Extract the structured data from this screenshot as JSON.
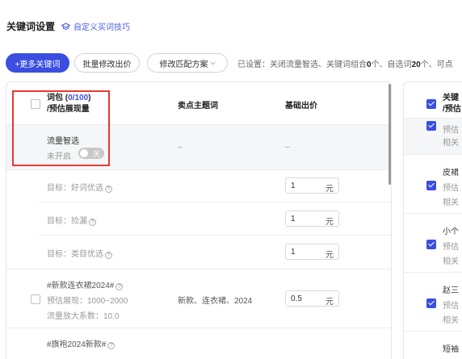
{
  "header": {
    "title": "关键词设置",
    "tip_label": "自定义买词技巧"
  },
  "toolbar": {
    "add_label": "+更多关键词",
    "bid_label": "批量修改出价",
    "match_label": "修改匹配方案",
    "status_prefix": "已设置：关闭流量智选、关键词组合",
    "combo_count": "0",
    "status_mid1": "个、自选词",
    "self_count": "20",
    "status_mid2": "个、可点"
  },
  "table": {
    "col_keyword_line1_pre": "词包 (",
    "col_keyword_count": "0/100",
    "col_keyword_line1_post": ")",
    "col_keyword_line2": "/预估展现量",
    "col_theme": "卖点主题词",
    "col_bid": "基础出价",
    "smart": {
      "name": "流量智选",
      "status": "未开启",
      "toggle": "关",
      "theme": "–",
      "bid": "–"
    },
    "targets": [
      {
        "label": "目标：好词优选",
        "bid": "1",
        "unit": "元"
      },
      {
        "label": "目标：捡漏",
        "bid": "1",
        "unit": "元"
      },
      {
        "label": "目标：类目优选",
        "bid": "1",
        "unit": "元"
      }
    ],
    "packages": [
      {
        "name": "#新款连衣裙2024#",
        "impression": "预估展现：1000~2000",
        "factor": "流量放大系数：10.0",
        "theme": "新款、连衣裙、2024",
        "bid": "0.5",
        "unit": "元"
      },
      {
        "name": "#旗袍2024新款#"
      }
    ]
  },
  "right_panel": {
    "header_line1": "关键",
    "header_line2": "/预估",
    "rows": [
      {
        "title": "",
        "sub1": "预估",
        "sub2": "相关"
      },
      {
        "title": "皮裙",
        "sub1": "预估",
        "sub2": "相关"
      },
      {
        "title": "小个",
        "sub1": "预估",
        "sub2": "相关"
      },
      {
        "title": "赵三",
        "sub1": "预估",
        "sub2": "相关"
      },
      {
        "title": "短袖",
        "sub1": "",
        "sub2": ""
      }
    ]
  }
}
